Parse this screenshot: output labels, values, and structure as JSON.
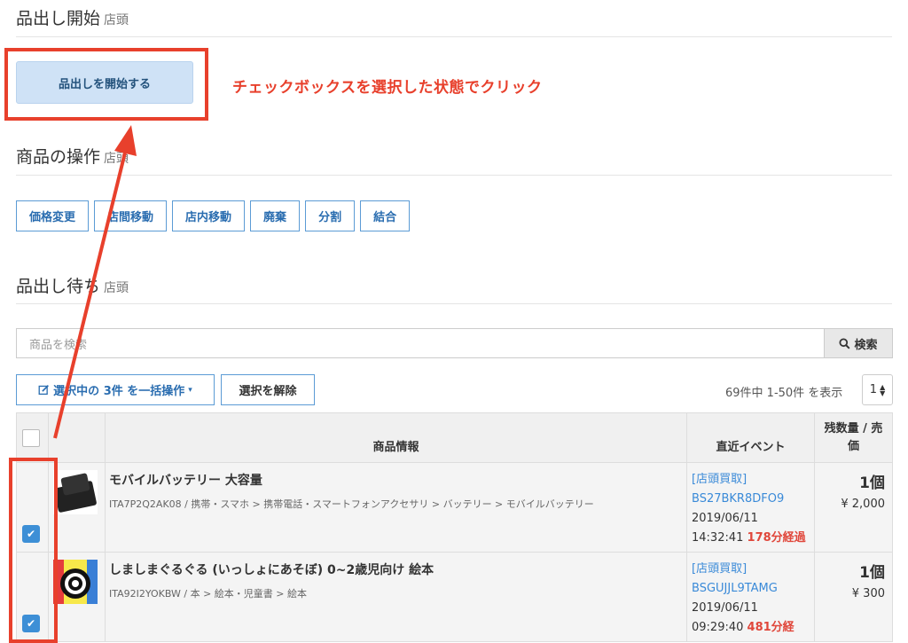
{
  "section1": {
    "title": "品出し開始",
    "sub": "店頭",
    "start_label": "品出しを開始する",
    "annotation": "チェックボックスを選択した状態でクリック"
  },
  "section2": {
    "title": "商品の操作",
    "sub": "店頭",
    "buttons": [
      "価格変更",
      "店間移動",
      "店内移動",
      "廃棄",
      "分割",
      "結合"
    ]
  },
  "section3": {
    "title": "品出し待ち",
    "sub": "店頭",
    "search_placeholder": "商品を検索",
    "search_label": "検索",
    "bulk_label": "選択中の 3件 を一括操作",
    "clear_label": "選択を解除",
    "count": "69件中 1-50件 を表示",
    "page": "1"
  },
  "table": {
    "headers": {
      "info": "商品情報",
      "event": "直近イベント",
      "qty": "残数量 / 売価"
    },
    "rows": [
      {
        "name": "モバイルバッテリー 大容量",
        "category": "ITA7P2Q2AK08 / 携帯・スマホ > 携帯電話・スマートフォンアクセサリ > バッテリー > モバイルバッテリー",
        "event_type": "[店頭買取]",
        "event_code": "BS27BKR8DFO9",
        "event_date": "2019/06/11",
        "event_time": "14:32:41",
        "elapsed": "178分経過",
        "qty": "1個",
        "price": "¥ 2,000"
      },
      {
        "name": "しましまぐるぐる (いっしょにあそぼ) 0~2歳児向け 絵本",
        "category": "ITA92I2YOKBW / 本 > 絵本・児童書 > 絵本",
        "event_type": "[店頭買取]",
        "event_code": "BSGUJJL9TAMG",
        "event_date": "2019/06/11",
        "event_time": "09:29:40",
        "elapsed": "481分経",
        "qty": "1個",
        "price": "¥ 300"
      }
    ]
  },
  "colors": {
    "accent": "#e8402c",
    "link": "#3a8ad8",
    "primary_light": "#cfe2f6"
  }
}
